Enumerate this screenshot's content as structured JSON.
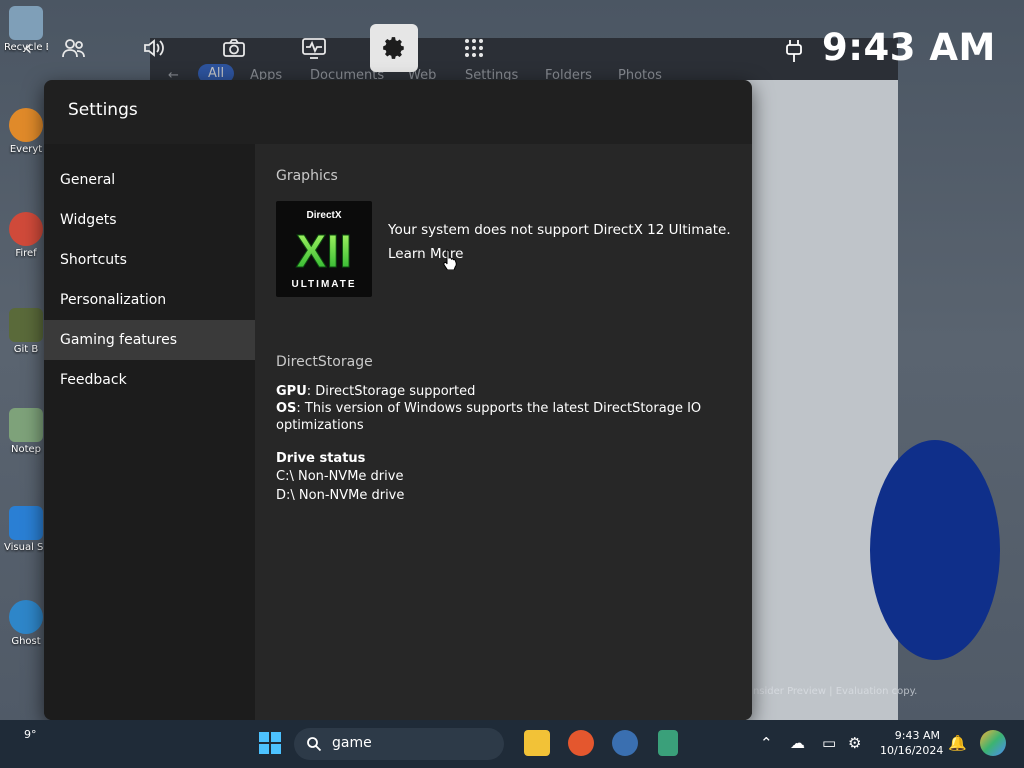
{
  "desktop": {
    "icons": [
      {
        "label": "Recycle Bin"
      },
      {
        "label": "Everyt"
      },
      {
        "label": "Firef"
      },
      {
        "label": "Git B"
      },
      {
        "label": "Notep"
      },
      {
        "label": "Visual S Cod"
      },
      {
        "label": "Ghost"
      }
    ],
    "watermark": "Insider Preview | Evaluation copy."
  },
  "background_window": {
    "tabs": [
      "All",
      "Apps",
      "Documents",
      "Web",
      "Settings",
      "Folders",
      "Photos"
    ]
  },
  "gamebar": {
    "time": "9:43 AM",
    "buttons": [
      "back-icon",
      "party-icon",
      "audio-icon",
      "capture-icon",
      "performance-icon",
      "settings-icon",
      "widget-menu-icon"
    ]
  },
  "settings": {
    "title": "Settings",
    "nav": [
      "General",
      "Widgets",
      "Shortcuts",
      "Personalization",
      "Gaming features",
      "Feedback"
    ],
    "selected_nav": "Gaming features",
    "graphics": {
      "label": "Graphics",
      "logo_top": "DirectX",
      "logo_mid": "XII",
      "logo_bottom": "ULTIMATE",
      "message": "Your system does not support DirectX 12 Ultimate.",
      "learn_more": "Learn More"
    },
    "directstorage": {
      "label": "DirectStorage",
      "gpu_key": "GPU",
      "gpu_value": ": DirectStorage supported",
      "os_key": "OS",
      "os_value": ": This version of Windows supports the latest DirectStorage IO optimizations",
      "drive_status_label": "Drive status",
      "drives": [
        "C:\\ Non-NVMe drive",
        "D:\\ Non-NVMe drive"
      ]
    }
  },
  "taskbar": {
    "weather": "9°",
    "search_value": "game",
    "time": "9:43 AM",
    "date": "10/16/2024"
  }
}
